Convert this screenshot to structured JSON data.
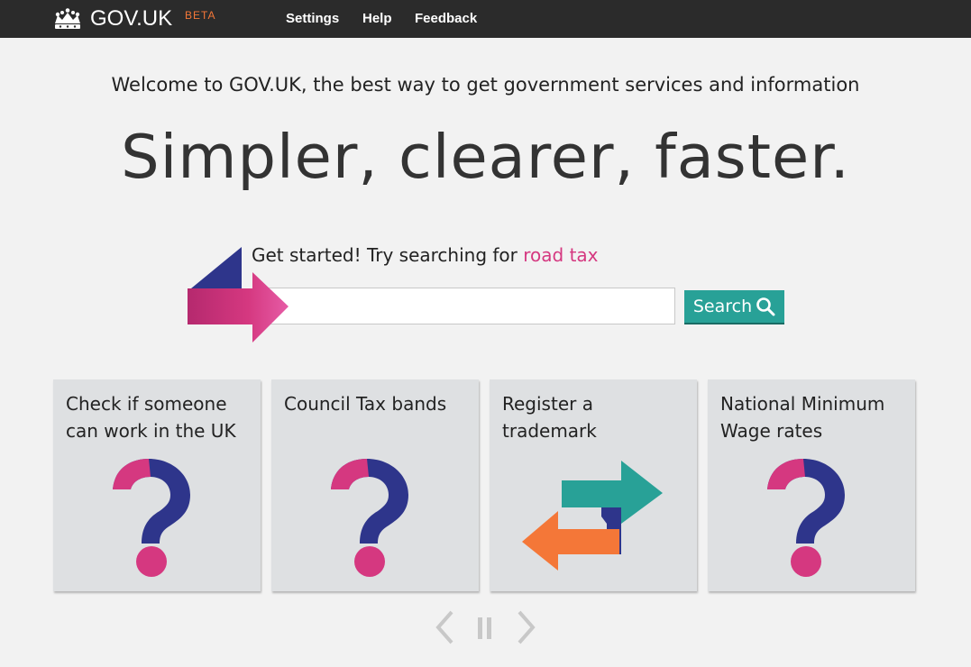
{
  "header": {
    "logo_text": "GOV.UK",
    "beta_label": "BETA",
    "nav": [
      {
        "label": "Settings"
      },
      {
        "label": "Help"
      },
      {
        "label": "Feedback"
      }
    ]
  },
  "hero": {
    "welcome": "Welcome to GOV.UK, the best way to get government services and information",
    "headline": "Simpler, clearer, faster."
  },
  "search": {
    "prompt_prefix": "Get started! Try searching for ",
    "prompt_link": "road tax",
    "input_value": "",
    "button_label": "Search"
  },
  "cards": [
    {
      "title": "Check if someone can work in the UK",
      "icon": "question-mark-icon"
    },
    {
      "title": "Council Tax bands",
      "icon": "question-mark-icon"
    },
    {
      "title": "Register a trademark",
      "icon": "swap-arrows-icon"
    },
    {
      "title": "National Minimum Wage rates",
      "icon": "question-mark-icon"
    }
  ],
  "carousel": {
    "controls": [
      "chevron-left-icon",
      "pause-icon",
      "chevron-right-icon"
    ]
  },
  "colors": {
    "topbar": "#2b2b2b",
    "beta": "#f47738",
    "link_pink": "#d53880",
    "search_green": "#28a197",
    "card_bg": "#dee0e2",
    "icon_navy": "#2e358b",
    "icon_teal": "#28a197",
    "icon_orange": "#f47738"
  }
}
